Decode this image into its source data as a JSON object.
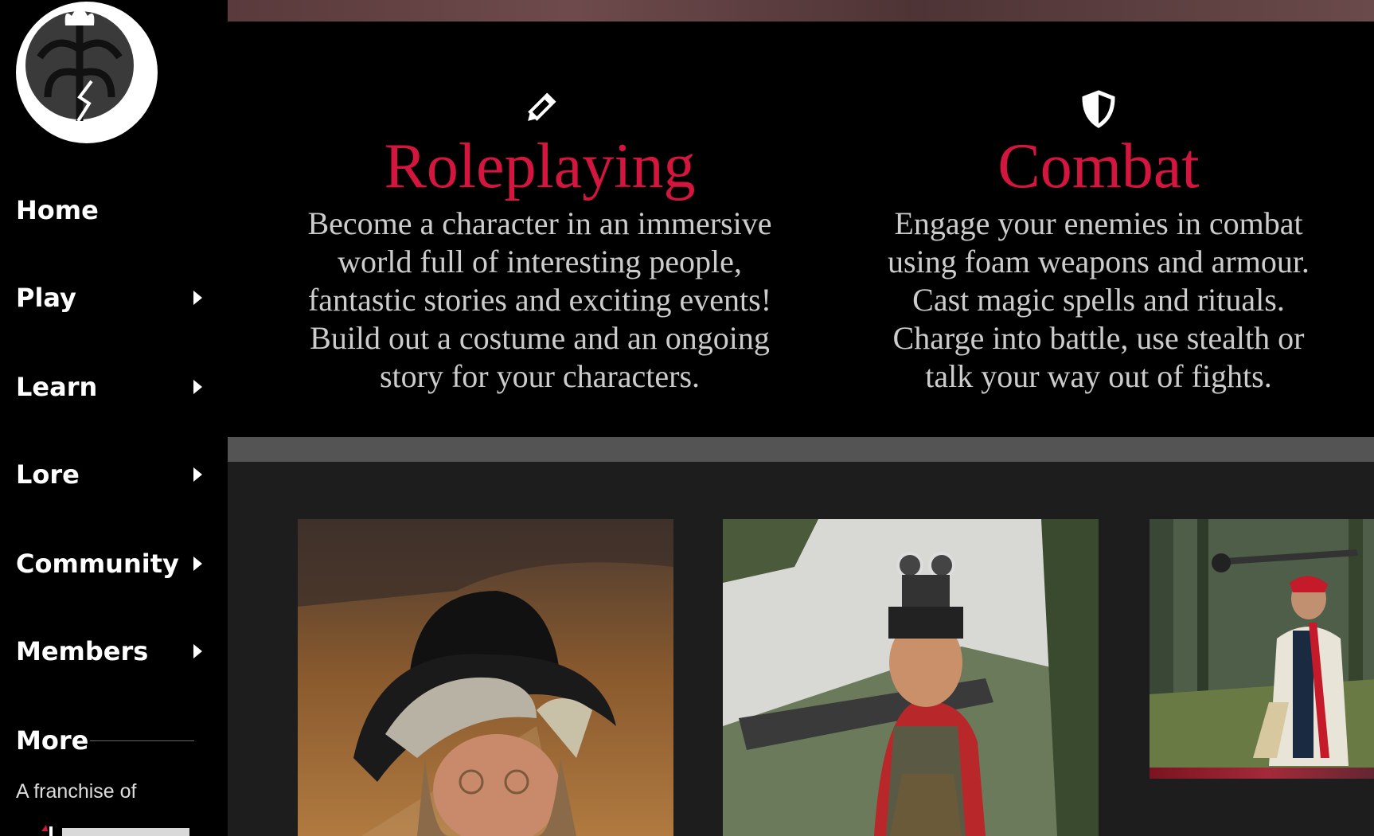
{
  "sidebar": {
    "items": [
      {
        "label": "Home",
        "has_submenu": false
      },
      {
        "label": "Play",
        "has_submenu": true
      },
      {
        "label": "Learn",
        "has_submenu": true
      },
      {
        "label": "Lore",
        "has_submenu": true
      },
      {
        "label": "Community",
        "has_submenu": true
      },
      {
        "label": "Members",
        "has_submenu": true
      }
    ],
    "more_label": "More",
    "franchise_text": "A franchise of"
  },
  "features": [
    {
      "icon": "pencil-icon",
      "title": "Roleplaying",
      "lines": [
        "Become a character in an immersive",
        "world full of interesting people,",
        "fantastic stories and exciting events!",
        "Build out a costume and an ongoing",
        "story for your characters."
      ]
    },
    {
      "icon": "shield-icon",
      "title": "Combat",
      "lines": [
        "Engage your enemies in combat",
        "using foam weapons and armour.",
        "Cast magic spells and rituals.",
        "Charge into battle, use stealth or",
        "talk your way out of fights."
      ]
    }
  ],
  "colors": {
    "accent": "#d4163f",
    "sidebar_bg": "#000000",
    "gallery_bg": "#1d1d1d",
    "divider": "#545454"
  }
}
